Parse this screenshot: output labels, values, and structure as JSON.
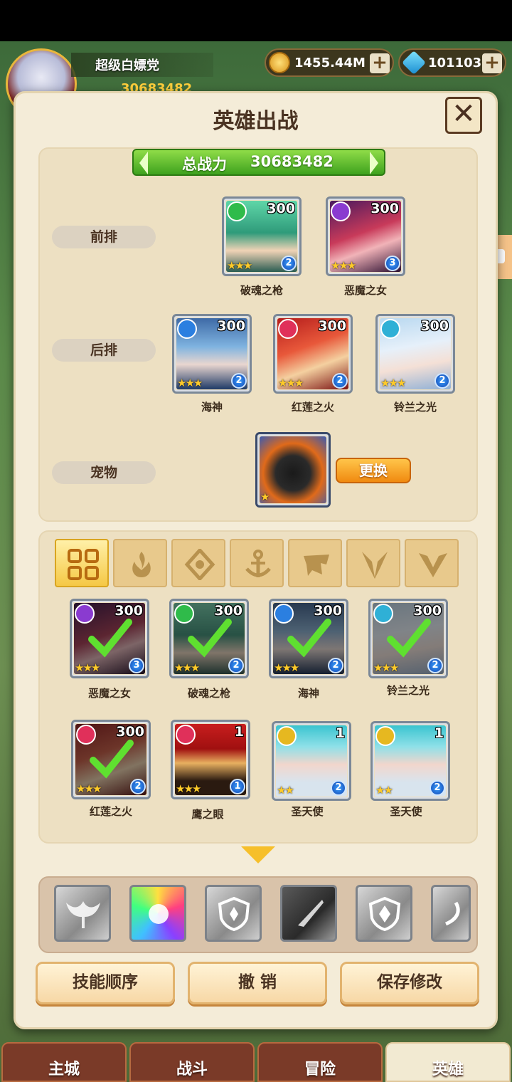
{
  "player": {
    "name": "超级白嫖党",
    "power": "30683482"
  },
  "currency": {
    "gold": "1455.44M",
    "gems": "101103"
  },
  "modal": {
    "title": "英雄出战",
    "total_power_label": "总战力",
    "total_power_value": "30683482"
  },
  "lineup": {
    "front_label": "前排",
    "back_label": "后排",
    "pet_label": "宠物",
    "swap_label": "更换",
    "front": [
      {
        "name": "破魂之枪",
        "level": "300",
        "rank": "2",
        "faction": "beast-faction-icon"
      },
      {
        "name": "恶魔之女",
        "level": "300",
        "rank": "3",
        "faction": "demon-faction-icon"
      }
    ],
    "back": [
      {
        "name": "海神",
        "level": "300",
        "rank": "2",
        "faction": "anchor-faction-icon"
      },
      {
        "name": "红莲之火",
        "level": "300",
        "rank": "2",
        "faction": "fire-faction-icon"
      },
      {
        "name": "铃兰之光",
        "level": "300",
        "rank": "2",
        "faction": "light-faction-icon"
      }
    ]
  },
  "filters": [
    "all-grid-icon",
    "fire-faction-icon",
    "light-faction-icon",
    "anchor-faction-icon",
    "beast-faction-icon",
    "demon-faction-icon",
    "holy-faction-icon"
  ],
  "roster": [
    {
      "name": "恶魔之女",
      "level": "300",
      "rank": "3",
      "selected": true
    },
    {
      "name": "破魂之枪",
      "level": "300",
      "rank": "2",
      "selected": true
    },
    {
      "name": "海神",
      "level": "300",
      "rank": "2",
      "selected": true
    },
    {
      "name": "铃兰之光",
      "level": "300",
      "rank": "2",
      "selected": true
    },
    {
      "name": "红莲之火",
      "level": "300",
      "rank": "2",
      "selected": true
    },
    {
      "name": "鹰之眼",
      "level": "1",
      "rank": "1",
      "selected": false
    },
    {
      "name": "圣天使",
      "level": "1",
      "rank": "2",
      "selected": false
    },
    {
      "name": "圣天使",
      "level": "1",
      "rank": "2",
      "selected": false
    }
  ],
  "actions": {
    "skill_order": "技能顺序",
    "undo": "撤 销",
    "save": "保存修改"
  },
  "nav": {
    "city": "主城",
    "battle": "战斗",
    "adventure": "冒险",
    "heroes": "英雄"
  },
  "colors": {
    "accent_green": "#3ea21e",
    "button_orange": "#f08a10",
    "panel_bg": "#ede0c2"
  }
}
